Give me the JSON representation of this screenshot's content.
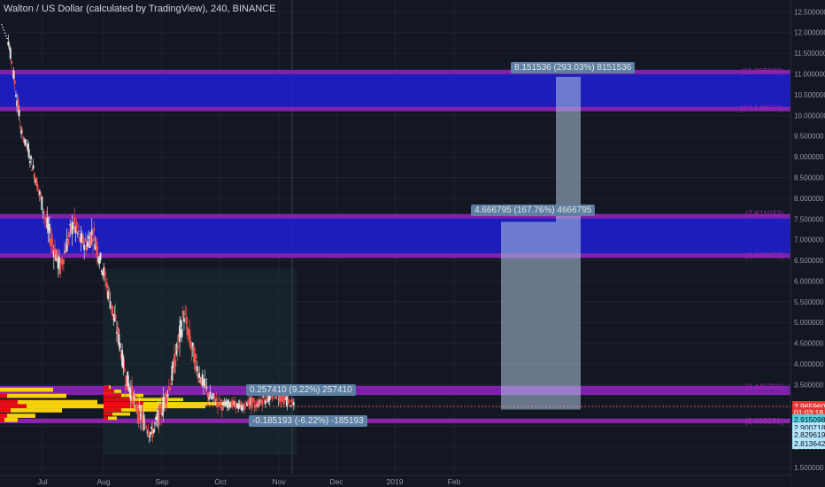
{
  "header": {
    "title": "Walton / US Dollar (calculated by TradingView), 240, BINANCE"
  },
  "colors": {
    "background": "#131722",
    "band_fill": "#1f1fd6",
    "band_edge": "#8e24aa",
    "projection": "#b3c7e0",
    "up_candle": "#e0e0e0",
    "down_candle": "#ef5350",
    "volume_profile_buy": "#f5d20a",
    "volume_profile_sell": "#e50914",
    "current_price": "#e53935",
    "axis_text": "#9598a1"
  },
  "price_tags": [
    {
      "label": "2.965960",
      "value": 2.96596,
      "bg": "#e53935",
      "fg": "#ffffff"
    },
    {
      "label": "01:03:18",
      "value": 2.83,
      "bg": "#e53935",
      "fg": "#ffffff"
    },
    {
      "label": "2.915098",
      "value": 2.66,
      "bg": "#4dd0e1",
      "fg": "#131722"
    },
    {
      "label": "2.900718",
      "value": 2.47,
      "bg": "#b3e5fc",
      "fg": "#131722"
    },
    {
      "label": "2.829619",
      "value": 2.28,
      "bg": "#b3e5fc",
      "fg": "#131722"
    },
    {
      "label": "2.813642",
      "value": 2.08,
      "bg": "#b3e5fc",
      "fg": "#131722"
    }
  ],
  "annotations": {
    "upper_target": "8.151536 (293.03%) 8151536",
    "mid_target": "4.666795 (167.76%) 4666795",
    "small_up": "0.257410 (9.22%) 257410",
    "small_down": "-0.185193 (-6.22%) -185193"
  },
  "chart_data": {
    "type": "candlestick",
    "title": "Walton / US Dollar (calculated by TradingView), 240, BINANCE",
    "x_ticks": [
      "Jul",
      "Aug",
      "Sep",
      "Oct",
      "Nov",
      "Dec",
      "2019",
      "Feb"
    ],
    "y_ticks": [
      "1.500000",
      "2.000000",
      "2.500000",
      "3.000000",
      "3.500000",
      "4.000000",
      "4.500000",
      "5.000000",
      "5.500000",
      "6.000000",
      "6.500000",
      "7.000000",
      "7.500000",
      "8.000000",
      "8.500000",
      "9.000000",
      "9.500000",
      "10.000000",
      "10.500000",
      "11.000000",
      "11.500000",
      "12.000000",
      "12.500000"
    ],
    "ylim": [
      1.35,
      12.7
    ],
    "grid": true,
    "current_price": 2.96596,
    "price_path": [
      [
        12.2,
        0.0
      ],
      [
        11.8,
        0.3
      ],
      [
        10.8,
        0.4
      ],
      [
        9.6,
        0.2
      ],
      [
        9.2,
        0.3
      ],
      [
        8.6,
        0.3
      ],
      [
        8.0,
        0.4
      ],
      [
        7.3,
        0.5
      ],
      [
        6.8,
        0.5
      ],
      [
        6.3,
        0.4
      ],
      [
        6.9,
        0.5
      ],
      [
        7.4,
        0.5
      ],
      [
        7.0,
        0.4
      ],
      [
        6.9,
        0.5
      ],
      [
        7.2,
        0.5
      ],
      [
        6.6,
        0.4
      ],
      [
        6.0,
        0.5
      ],
      [
        5.3,
        0.5
      ],
      [
        4.6,
        0.4
      ],
      [
        3.7,
        0.5
      ],
      [
        3.3,
        0.4
      ],
      [
        2.8,
        0.5
      ],
      [
        2.6,
        0.4
      ],
      [
        2.3,
        0.4
      ],
      [
        2.7,
        0.5
      ],
      [
        3.1,
        0.4
      ],
      [
        3.6,
        0.5
      ],
      [
        4.4,
        0.6
      ],
      [
        5.2,
        0.5
      ],
      [
        4.5,
        0.5
      ],
      [
        3.9,
        0.4
      ],
      [
        3.5,
        0.4
      ],
      [
        3.2,
        0.3
      ],
      [
        3.1,
        0.3
      ],
      [
        3.0,
        0.2
      ],
      [
        3.05,
        0.2
      ],
      [
        3.0,
        0.2
      ],
      [
        2.95,
        0.2
      ],
      [
        3.1,
        0.3
      ],
      [
        3.0,
        0.2
      ],
      [
        3.15,
        0.3
      ],
      [
        3.2,
        0.3
      ],
      [
        3.3,
        0.3
      ],
      [
        3.2,
        0.3
      ],
      [
        3.1,
        0.2
      ],
      [
        2.97,
        0.2
      ]
    ],
    "zones": [
      {
        "from": 10.1,
        "to": 11.1,
        "labels": [
          "(11.095930)",
          "(10.149666)"
        ]
      },
      {
        "from": 6.56,
        "to": 7.62,
        "labels": [
          "(7.611033)",
          "(6.609473)"
        ]
      },
      {
        "from": 3.25,
        "to": 3.47,
        "labels": [
          "(3.445766)"
        ]
      },
      {
        "from": 2.57,
        "to": 2.68,
        "labels": [
          "(2.633281)"
        ]
      }
    ],
    "projections": [
      {
        "from": 2.9,
        "to": 7.43,
        "label": "4.666795 (167.76%) 4666795"
      },
      {
        "from": 2.9,
        "to": 10.93,
        "label": "8.151536 (293.03%) 8151536"
      }
    ]
  }
}
